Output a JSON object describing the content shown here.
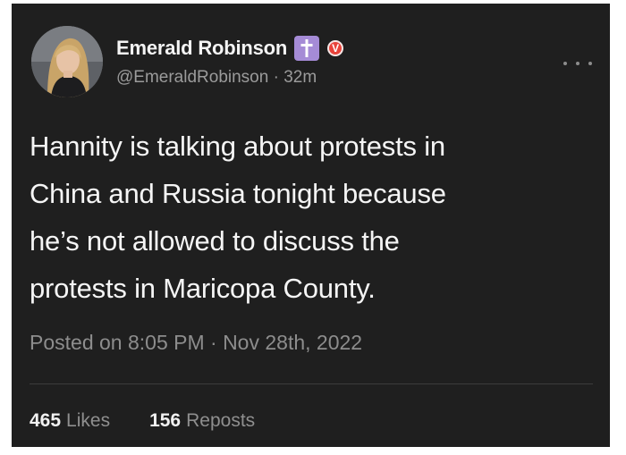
{
  "user": {
    "display_name": "Emerald Robinson",
    "handle": "@EmeraldRobinson",
    "separator": "·",
    "time_ago": "32m",
    "verified_badge": "V",
    "cross_badge_icon": "latin-cross-icon"
  },
  "post": {
    "lines": [
      "Hannity is talking about protests in",
      "China and Russia tonight because",
      "he’s not allowed to discuss the",
      "protests in Maricopa County."
    ],
    "posted_on": "Posted on 8:05 PM · Nov 28th, 2022"
  },
  "stats": {
    "likes_count": "465",
    "likes_label": "Likes",
    "reposts_count": "156",
    "reposts_label": "Reposts"
  },
  "colors": {
    "background": "#1f1f1f",
    "text": "#f5f5f5",
    "muted": "#8d8d8d",
    "cross_badge": "#a58bd6",
    "verified_badge": "#e8433a"
  }
}
